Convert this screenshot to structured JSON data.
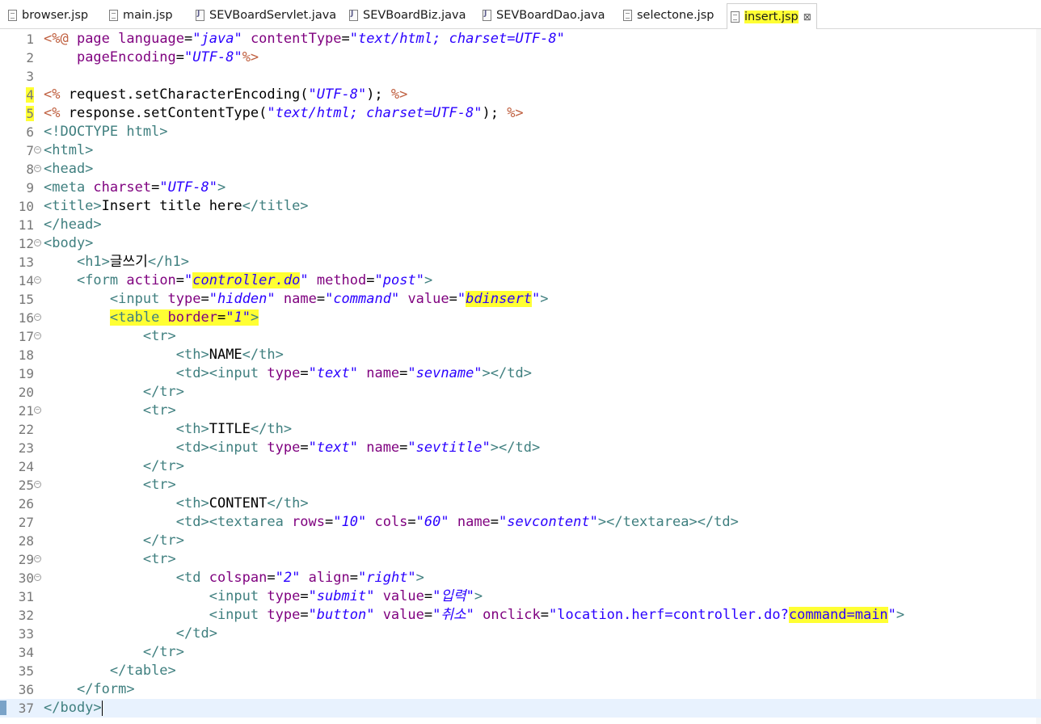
{
  "tabs": [
    {
      "label": "browser.jsp",
      "icon": "jsp-file-icon",
      "active": false
    },
    {
      "label": "main.jsp",
      "icon": "jsp-file-icon",
      "active": false
    },
    {
      "label": "SEVBoardServlet.java",
      "icon": "java-file-icon",
      "active": false
    },
    {
      "label": "SEVBoardBiz.java",
      "icon": "java-file-icon",
      "active": false
    },
    {
      "label": "SEVBoardDao.java",
      "icon": "java-file-icon",
      "active": false
    },
    {
      "label": "selectone.jsp",
      "icon": "jsp-file-icon",
      "active": false
    },
    {
      "label": "insert.jsp",
      "icon": "jsp-file-icon",
      "active": true,
      "highlighted": true,
      "close": "⊠"
    }
  ],
  "colors": {
    "tag": "#3f7f7f",
    "attr": "#7f007f",
    "value": "#2a00ff",
    "directive": "#bf5f3f",
    "text": "#000000",
    "highlight": "#ffff33",
    "line_number": "#787878",
    "current_line": "#e8f2fe"
  },
  "editor": {
    "current_line": 37,
    "lines": [
      {
        "n": "1",
        "spans": [
          [
            "directive",
            "<%@ "
          ],
          [
            "attr",
            "page "
          ],
          [
            "attr",
            "language"
          ],
          [
            "text",
            "="
          ],
          [
            "value",
            "\"java\" "
          ],
          [
            "attr",
            "contentType"
          ],
          [
            "text",
            "="
          ],
          [
            "value",
            "\"text/html; charset=UTF-8\""
          ]
        ]
      },
      {
        "n": "2",
        "spans": [
          [
            "text",
            "    "
          ],
          [
            "attr",
            "pageEncoding"
          ],
          [
            "text",
            "="
          ],
          [
            "value",
            "\"UTF-8\""
          ],
          [
            "directive",
            "%>"
          ]
        ]
      },
      {
        "n": "3",
        "spans": []
      },
      {
        "n": "4",
        "marked": true,
        "spans": [
          [
            "directive",
            "<% "
          ],
          [
            "text",
            "request.setCharacterEncoding("
          ],
          [
            "value",
            "\"UTF-8\""
          ],
          [
            "text",
            "); "
          ],
          [
            "directive",
            "%>"
          ]
        ]
      },
      {
        "n": "5",
        "marked": true,
        "spans": [
          [
            "directive",
            "<% "
          ],
          [
            "text",
            "response.setContentType("
          ],
          [
            "value",
            "\"text/html; charset=UTF-8\""
          ],
          [
            "text",
            "); "
          ],
          [
            "directive",
            "%>"
          ]
        ]
      },
      {
        "n": "6",
        "spans": [
          [
            "tag",
            "<!DOCTYPE html>"
          ]
        ]
      },
      {
        "n": "7",
        "fold": true,
        "spans": [
          [
            "tag",
            "<html>"
          ]
        ]
      },
      {
        "n": "8",
        "fold": true,
        "spans": [
          [
            "tag",
            "<head>"
          ]
        ]
      },
      {
        "n": "9",
        "spans": [
          [
            "tag",
            "<meta "
          ],
          [
            "attr",
            "charset"
          ],
          [
            "text",
            "="
          ],
          [
            "value",
            "\"UTF-8\""
          ],
          [
            "tag",
            ">"
          ]
        ]
      },
      {
        "n": "10",
        "spans": [
          [
            "tag",
            "<title>"
          ],
          [
            "text",
            "Insert title here"
          ],
          [
            "tag",
            "</title>"
          ]
        ]
      },
      {
        "n": "11",
        "spans": [
          [
            "tag",
            "</head>"
          ]
        ]
      },
      {
        "n": "12",
        "fold": true,
        "spans": [
          [
            "tag",
            "<body>"
          ]
        ]
      },
      {
        "n": "13",
        "spans": [
          [
            "text",
            "    "
          ],
          [
            "tag",
            "<h1>"
          ],
          [
            "text",
            "글쓰기"
          ],
          [
            "tag",
            "</h1>"
          ]
        ]
      },
      {
        "n": "14",
        "fold": true,
        "spans": [
          [
            "text",
            "    "
          ],
          [
            "tag",
            "<form "
          ],
          [
            "attr",
            "action"
          ],
          [
            "text",
            "="
          ],
          [
            "value",
            "\""
          ],
          [
            "valuehl",
            "controller.do"
          ],
          [
            "value",
            "\" "
          ],
          [
            "attr",
            "method"
          ],
          [
            "text",
            "="
          ],
          [
            "value",
            "\"post\""
          ],
          [
            "tag",
            ">"
          ]
        ]
      },
      {
        "n": "15",
        "spans": [
          [
            "text",
            "        "
          ],
          [
            "tag",
            "<input "
          ],
          [
            "attr",
            "type"
          ],
          [
            "text",
            "="
          ],
          [
            "value",
            "\"hidden\" "
          ],
          [
            "attr",
            "name"
          ],
          [
            "text",
            "="
          ],
          [
            "value",
            "\"command\" "
          ],
          [
            "attr",
            "value"
          ],
          [
            "text",
            "="
          ],
          [
            "value",
            "\""
          ],
          [
            "valuehl",
            "bdinsert"
          ],
          [
            "value",
            "\""
          ],
          [
            "tag",
            ">"
          ]
        ]
      },
      {
        "n": "16",
        "fold": true,
        "spans": [
          [
            "text",
            "        "
          ],
          [
            "taghl",
            "<table "
          ],
          [
            "attrhl",
            "border"
          ],
          [
            "texthl",
            "="
          ],
          [
            "valuehl",
            "\"1\""
          ],
          [
            "taghl",
            ">"
          ]
        ]
      },
      {
        "n": "17",
        "fold": true,
        "spans": [
          [
            "text",
            "            "
          ],
          [
            "tag",
            "<tr>"
          ]
        ]
      },
      {
        "n": "18",
        "spans": [
          [
            "text",
            "                "
          ],
          [
            "tag",
            "<th>"
          ],
          [
            "text",
            "NAME"
          ],
          [
            "tag",
            "</th>"
          ]
        ]
      },
      {
        "n": "19",
        "spans": [
          [
            "text",
            "                "
          ],
          [
            "tag",
            "<td><input "
          ],
          [
            "attr",
            "type"
          ],
          [
            "text",
            "="
          ],
          [
            "value",
            "\"text\" "
          ],
          [
            "attr",
            "name"
          ],
          [
            "text",
            "="
          ],
          [
            "value",
            "\"sevname\""
          ],
          [
            "tag",
            "></td>"
          ]
        ]
      },
      {
        "n": "20",
        "spans": [
          [
            "text",
            "            "
          ],
          [
            "tag",
            "</tr>"
          ]
        ]
      },
      {
        "n": "21",
        "fold": true,
        "spans": [
          [
            "text",
            "            "
          ],
          [
            "tag",
            "<tr>"
          ]
        ]
      },
      {
        "n": "22",
        "spans": [
          [
            "text",
            "                "
          ],
          [
            "tag",
            "<th>"
          ],
          [
            "text",
            "TITLE"
          ],
          [
            "tag",
            "</th>"
          ]
        ]
      },
      {
        "n": "23",
        "spans": [
          [
            "text",
            "                "
          ],
          [
            "tag",
            "<td><input "
          ],
          [
            "attr",
            "type"
          ],
          [
            "text",
            "="
          ],
          [
            "value",
            "\"text\" "
          ],
          [
            "attr",
            "name"
          ],
          [
            "text",
            "="
          ],
          [
            "value",
            "\"sevtitle\""
          ],
          [
            "tag",
            "></td>"
          ]
        ]
      },
      {
        "n": "24",
        "spans": [
          [
            "text",
            "            "
          ],
          [
            "tag",
            "</tr>"
          ]
        ]
      },
      {
        "n": "25",
        "fold": true,
        "spans": [
          [
            "text",
            "            "
          ],
          [
            "tag",
            "<tr>"
          ]
        ]
      },
      {
        "n": "26",
        "spans": [
          [
            "text",
            "                "
          ],
          [
            "tag",
            "<th>"
          ],
          [
            "text",
            "CONTENT"
          ],
          [
            "tag",
            "</th>"
          ]
        ]
      },
      {
        "n": "27",
        "spans": [
          [
            "text",
            "                "
          ],
          [
            "tag",
            "<td><textarea "
          ],
          [
            "attr",
            "rows"
          ],
          [
            "text",
            "="
          ],
          [
            "value",
            "\"10\" "
          ],
          [
            "attr",
            "cols"
          ],
          [
            "text",
            "="
          ],
          [
            "value",
            "\"60\" "
          ],
          [
            "attr",
            "name"
          ],
          [
            "text",
            "="
          ],
          [
            "value",
            "\"sevcontent\""
          ],
          [
            "tag",
            "></textarea></td>"
          ]
        ]
      },
      {
        "n": "28",
        "spans": [
          [
            "text",
            "            "
          ],
          [
            "tag",
            "</tr>"
          ]
        ]
      },
      {
        "n": "29",
        "fold": true,
        "spans": [
          [
            "text",
            "            "
          ],
          [
            "tag",
            "<tr>"
          ]
        ]
      },
      {
        "n": "30",
        "fold": true,
        "spans": [
          [
            "text",
            "                "
          ],
          [
            "tag",
            "<td "
          ],
          [
            "attr",
            "colspan"
          ],
          [
            "text",
            "="
          ],
          [
            "value",
            "\"2\" "
          ],
          [
            "attr",
            "align"
          ],
          [
            "text",
            "="
          ],
          [
            "value",
            "\"right\""
          ],
          [
            "tag",
            ">"
          ]
        ]
      },
      {
        "n": "31",
        "spans": [
          [
            "text",
            "                    "
          ],
          [
            "tag",
            "<input "
          ],
          [
            "attr",
            "type"
          ],
          [
            "text",
            "="
          ],
          [
            "value",
            "\"submit\" "
          ],
          [
            "attr",
            "value"
          ],
          [
            "text",
            "="
          ],
          [
            "value",
            "\"입력\""
          ],
          [
            "tag",
            ">"
          ]
        ]
      },
      {
        "n": "32",
        "spans": [
          [
            "text",
            "                    "
          ],
          [
            "tag",
            "<input "
          ],
          [
            "attr",
            "type"
          ],
          [
            "text",
            "="
          ],
          [
            "value",
            "\"button\" "
          ],
          [
            "attr",
            "value"
          ],
          [
            "text",
            "="
          ],
          [
            "value",
            "\"취소\" "
          ],
          [
            "attr",
            "onclick"
          ],
          [
            "text",
            "="
          ],
          [
            "value2",
            "\"location.herf=controller.do?"
          ],
          [
            "value2hl",
            "command=main"
          ],
          [
            "value2",
            "\""
          ],
          [
            "tag",
            ">"
          ]
        ]
      },
      {
        "n": "33",
        "spans": [
          [
            "text",
            "                "
          ],
          [
            "tag",
            "</td>"
          ]
        ]
      },
      {
        "n": "34",
        "spans": [
          [
            "text",
            "            "
          ],
          [
            "tag",
            "</tr>"
          ]
        ]
      },
      {
        "n": "35",
        "spans": [
          [
            "text",
            "        "
          ],
          [
            "tag",
            "</table>"
          ]
        ]
      },
      {
        "n": "36",
        "spans": [
          [
            "text",
            "    "
          ],
          [
            "tag",
            "</form>"
          ]
        ]
      },
      {
        "n": "37",
        "spans": [
          [
            "tag",
            "</body>"
          ]
        ]
      }
    ]
  }
}
